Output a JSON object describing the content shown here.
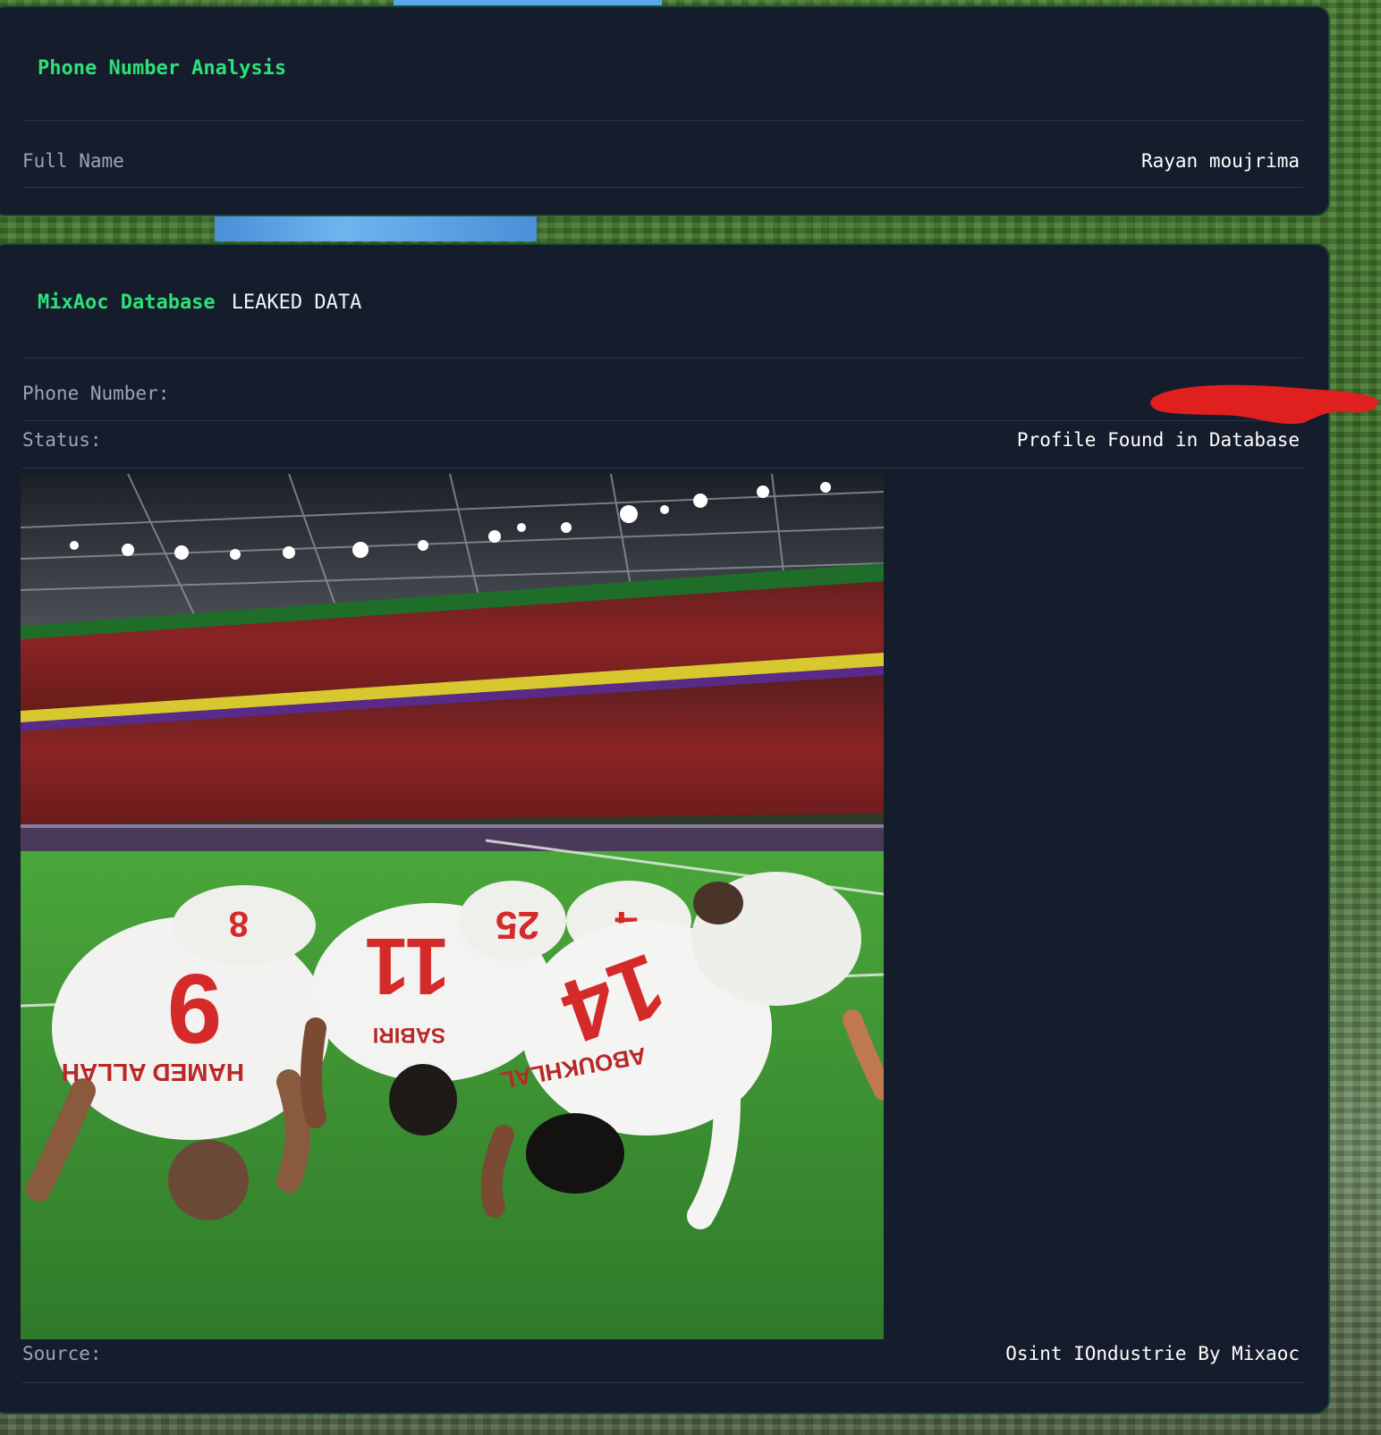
{
  "colors": {
    "panel_bg": "#151c2b",
    "accent_green": "#2de07a",
    "label_gray": "#9aa6b6",
    "value_white": "#ffffff",
    "redaction_red": "#e01f1f"
  },
  "analysis_panel": {
    "title": "Phone Number Analysis",
    "rows": [
      {
        "label": "Full Name",
        "value": "Rayan moujrima"
      }
    ]
  },
  "database_panel": {
    "title": "MixAoc Database",
    "title_suffix": "LEAKED DATA",
    "phone_label": "Phone Number:",
    "status_label": "Status:",
    "status_value": "Profile Found in Database",
    "source_label": "Source:",
    "source_value": "Osint IOndustrie By Mixaoc",
    "jersey_numbers": [
      "9",
      "11",
      "14",
      "4",
      "8",
      "25"
    ],
    "jersey_names": [
      "HAMED ALLAH",
      "SABIRI",
      "ABOUKHLAL"
    ]
  }
}
